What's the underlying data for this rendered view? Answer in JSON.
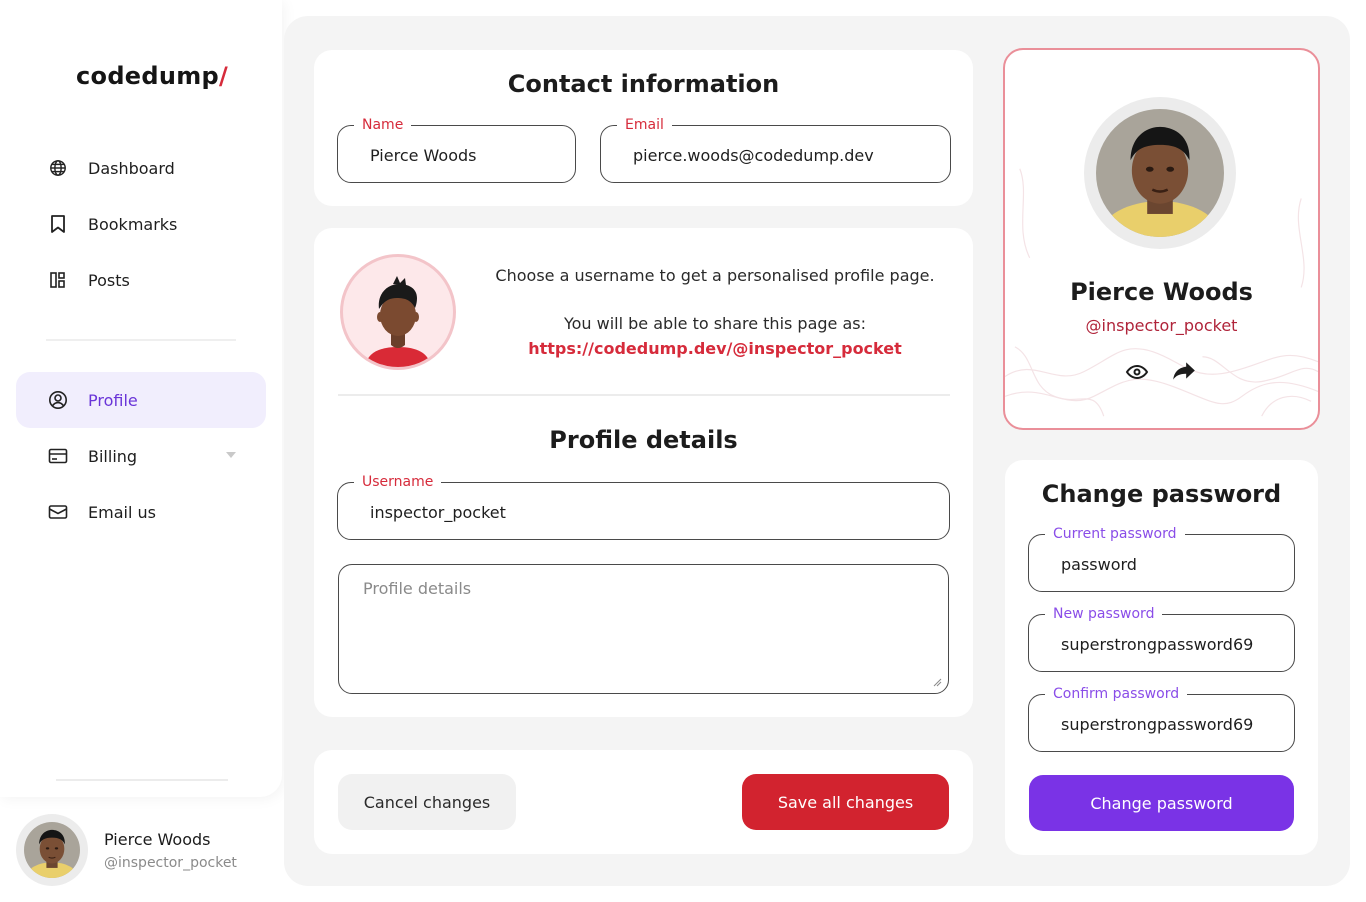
{
  "brand": {
    "name": "codedump",
    "slash": "/"
  },
  "nav": {
    "dashboard": "Dashboard",
    "bookmarks": "Bookmarks",
    "posts": "Posts",
    "profile": "Profile",
    "billing": "Billing",
    "email": "Email us"
  },
  "user": {
    "name": "Pierce Woods",
    "handle": "@inspector_pocket"
  },
  "contact": {
    "title": "Contact information",
    "name_label": "Name",
    "name_value": "Pierce Woods",
    "email_label": "Email",
    "email_value": "pierce.woods@codedump.dev"
  },
  "profile": {
    "intro1": "Choose a username to get a personalised profile page.",
    "intro2": "You will be able to share this page as:",
    "link": "https://codedump.dev/@inspector_pocket",
    "details_title": "Profile details",
    "username_label": "Username",
    "username_value": "inspector_pocket",
    "details_placeholder": "Profile details"
  },
  "actions": {
    "cancel": "Cancel changes",
    "save": "Save all changes"
  },
  "password": {
    "title": "Change password",
    "current_label": "Current password",
    "current_value": "password",
    "new_label": "New password",
    "new_value": "superstrongpassword69",
    "confirm_label": "Confirm password",
    "confirm_value": "superstrongpassword69",
    "button": "Change password"
  },
  "colors": {
    "accent_red": "#d2232f",
    "accent_purple": "#7a33e6",
    "active_bg": "#f1eefd"
  },
  "icons": [
    "globe-icon",
    "bookmark-icon",
    "posts-icon",
    "user-circle-icon",
    "credit-card-icon",
    "mail-icon",
    "eye-icon",
    "share-icon",
    "chevron-down-icon"
  ]
}
